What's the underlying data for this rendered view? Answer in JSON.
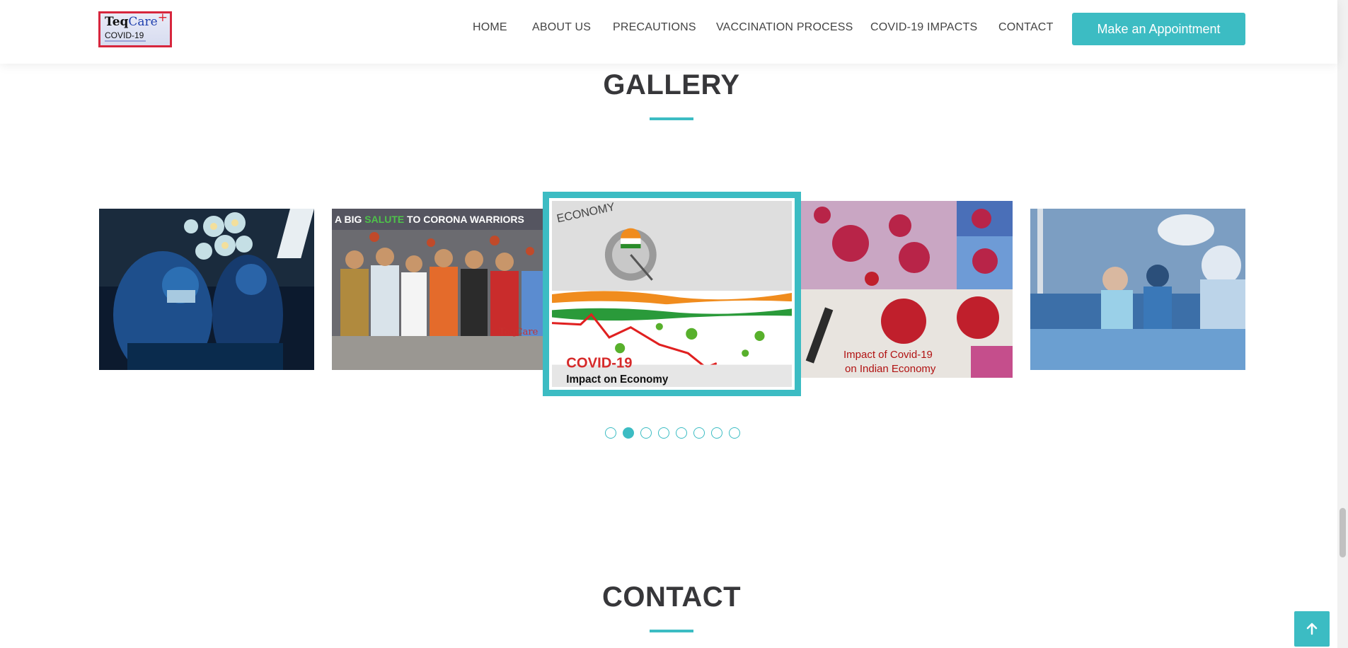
{
  "brand": {
    "name_part1": "Teq",
    "name_part2": "Care",
    "plus": "+",
    "sub": "COVID-19"
  },
  "nav": {
    "items": [
      {
        "label": "HOME"
      },
      {
        "label": "ABOUT US"
      },
      {
        "label": "PRECAUTIONS"
      },
      {
        "label": "VACCINATION PROCESS"
      },
      {
        "label": "COVID-19 IMPACTS"
      },
      {
        "label": "CONTACT"
      }
    ],
    "cta_label": "Make an Appointment"
  },
  "gallery": {
    "title": "GALLERY",
    "slides": [
      {
        "icon": "surgery-photo"
      },
      {
        "icon": "corona-warriors-mural",
        "text": "A BIG SALUTE TO CORONA WARRIORS",
        "word1": "A BIG ",
        "word2": "SALUTE",
        "word3": " TO CORONA WARRIORS",
        "watermark": "TeqCare"
      },
      {
        "icon": "economy-impact-graphic",
        "top_text": "ECONOMY",
        "headline": "COVID-19",
        "subline": "Impact on Economy"
      },
      {
        "icon": "covid-indian-economy-collage",
        "caption_line1": "Impact of Covid-19",
        "caption_line2": "on Indian Economy"
      },
      {
        "icon": "operation-room-photo"
      }
    ],
    "dots_count": 8,
    "active_dot": 2
  },
  "contact": {
    "title": "CONTACT"
  },
  "colors": {
    "accent": "#3cbcc3",
    "heading": "#37373a",
    "nav_text": "#444444"
  }
}
